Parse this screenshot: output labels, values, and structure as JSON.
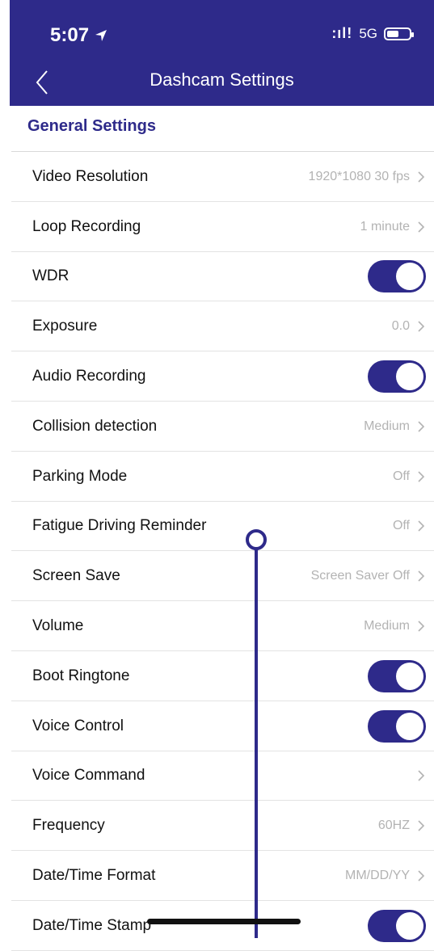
{
  "status_bar": {
    "time": "5:07",
    "signal": ":ıl!",
    "network": "5G"
  },
  "header": {
    "title": "Dashcam Settings"
  },
  "section": {
    "title": "General Settings"
  },
  "items": [
    {
      "label": "Video Resolution",
      "value": "1920*1080 30 fps",
      "type": "nav"
    },
    {
      "label": "Loop Recording",
      "value": "1 minute",
      "type": "nav"
    },
    {
      "label": "WDR",
      "type": "toggle",
      "on": true
    },
    {
      "label": "Exposure",
      "value": "0.0",
      "type": "nav"
    },
    {
      "label": "Audio Recording",
      "type": "toggle",
      "on": true
    },
    {
      "label": "Collision detection",
      "value": "Medium",
      "type": "nav"
    },
    {
      "label": "Parking Mode",
      "value": "Off",
      "type": "nav"
    },
    {
      "label": "Fatigue Driving Reminder",
      "value": "Off",
      "type": "nav"
    },
    {
      "label": "Screen Save",
      "value": "Screen Saver Off",
      "type": "nav"
    },
    {
      "label": "Volume",
      "value": "Medium",
      "type": "nav"
    },
    {
      "label": "Boot Ringtone",
      "type": "toggle",
      "on": true
    },
    {
      "label": "Voice Control",
      "type": "toggle",
      "on": true
    },
    {
      "label": "Voice Command",
      "value": "",
      "type": "nav"
    },
    {
      "label": "Frequency",
      "value": "60HZ",
      "type": "nav"
    },
    {
      "label": "Date/Time Format",
      "value": "MM/DD/YY",
      "type": "nav"
    },
    {
      "label": "Date/Time Stamp",
      "type": "toggle",
      "on": true
    }
  ],
  "colors": {
    "accent": "#2e2a8a",
    "value_text": "#b3b3b3"
  }
}
